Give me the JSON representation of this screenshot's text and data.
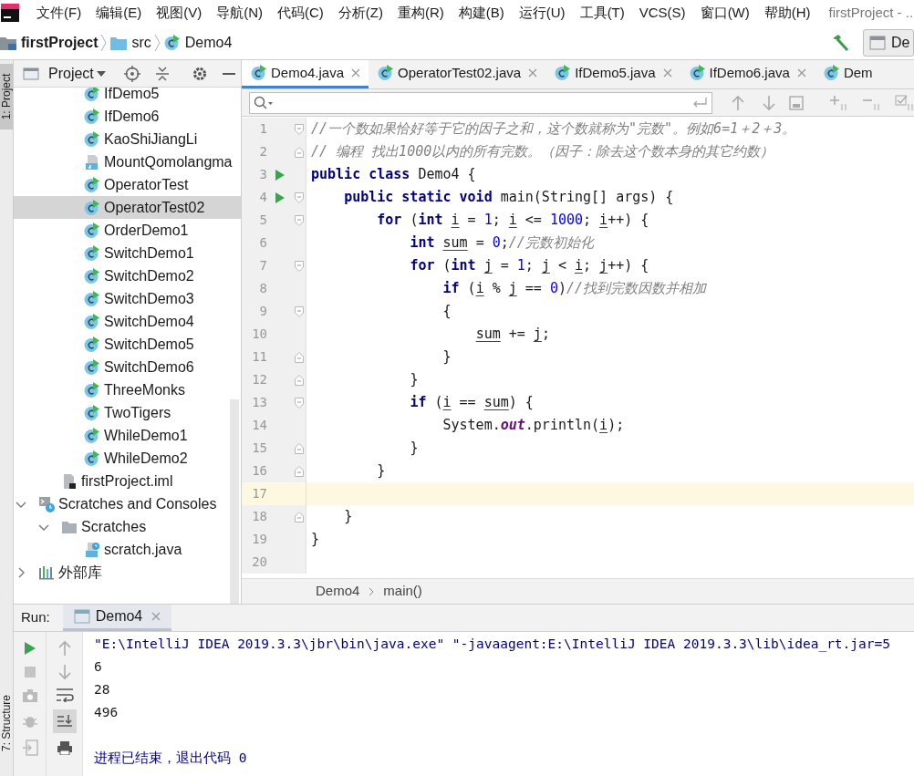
{
  "window": {
    "title": "firstProject - ..."
  },
  "menu": [
    "文件(F)",
    "编辑(E)",
    "视图(V)",
    "导航(N)",
    "代码(C)",
    "分析(Z)",
    "重构(R)",
    "构建(B)",
    "运行(U)",
    "工具(T)",
    "VCS(S)",
    "窗口(W)",
    "帮助(H)"
  ],
  "navigation_bar": {
    "path": [
      {
        "label": "firstProject",
        "kind": "project"
      },
      {
        "label": "src",
        "kind": "folder"
      },
      {
        "label": "Demo4",
        "kind": "class"
      }
    ],
    "run_configuration": "De"
  },
  "side_tabs": [
    {
      "label": "1: Project",
      "selected": true
    },
    {
      "label": "7: Structure",
      "selected": false
    }
  ],
  "project_panel": {
    "title": "Project",
    "tree": [
      {
        "children": [
          {
            "children": [
              {
                "label": "IfDemo5",
                "kind": "class",
                "selected": false
              },
              {
                "label": "IfDemo6",
                "kind": "class",
                "selected": false
              },
              {
                "label": "KaoShiJiangLi",
                "kind": "class",
                "selected": false
              },
              {
                "label": "MountQomolangma",
                "kind": "java_file",
                "selected": false
              },
              {
                "label": "OperatorTest",
                "kind": "class",
                "selected": false
              },
              {
                "label": "OperatorTest02",
                "kind": "class",
                "selected": true
              },
              {
                "label": "OrderDemo1",
                "kind": "class",
                "selected": false
              },
              {
                "label": "SwitchDemo1",
                "kind": "class",
                "selected": false
              },
              {
                "label": "SwitchDemo2",
                "kind": "class",
                "selected": false
              },
              {
                "label": "SwitchDemo3",
                "kind": "class",
                "selected": false
              },
              {
                "label": "SwitchDemo4",
                "kind": "class",
                "selected": false
              },
              {
                "label": "SwitchDemo5",
                "kind": "class",
                "selected": false
              },
              {
                "label": "SwitchDemo6",
                "kind": "class",
                "selected": false
              },
              {
                "label": "ThreeMonks",
                "kind": "class",
                "selected": false
              },
              {
                "label": "TwoTigers",
                "kind": "class",
                "selected": false
              },
              {
                "label": "WhileDemo1",
                "kind": "class",
                "selected": false
              },
              {
                "label": "WhileDemo2",
                "kind": "class",
                "selected": false
              }
            ]
          },
          {
            "label": "firstProject.iml",
            "kind": "module_file",
            "selected": false
          }
        ]
      },
      {
        "label": "Scratches and Consoles",
        "kind": "scratches",
        "selected": false,
        "expanded": true,
        "children": [
          {
            "label": "Scratches",
            "kind": "folder",
            "selected": false,
            "expanded": true,
            "children": [
              {
                "label": "scratch.java",
                "kind": "scratch_file",
                "selected": false
              }
            ]
          }
        ]
      },
      {
        "label": "外部库",
        "kind": "library",
        "selected": false,
        "expanded": false
      }
    ]
  },
  "editor": {
    "tabs": [
      {
        "label": "Demo4.java",
        "selected": true,
        "closable": true
      },
      {
        "label": "OperatorTest02.java",
        "selected": false,
        "closable": true
      },
      {
        "label": "IfDemo5.java",
        "selected": false,
        "closable": true
      },
      {
        "label": "IfDemo6.java",
        "selected": false,
        "closable": true
      },
      {
        "label": "Dem",
        "selected": false,
        "closable": false
      }
    ],
    "lines": [
      {
        "number": "1",
        "fold_start": true,
        "tokens": [
          {
            "kind": "comment",
            "text": "//一个数如果恰好等于它的因子之和，这个数就称为\"完数\"。例如6=1＋2＋3。"
          }
        ]
      },
      {
        "number": "2",
        "fold_end": true,
        "tokens": [
          {
            "kind": "comment",
            "text": "// 编程 找出1000以内的所有完数。（因子：除去这个数本身的其它约数）"
          }
        ]
      },
      {
        "number": "3",
        "run": true,
        "tokens": [
          {
            "kind": "keyword",
            "text": "public class"
          },
          {
            "kind": "plain",
            "text": " Demo4 {"
          }
        ]
      },
      {
        "number": "4",
        "run": true,
        "fold_start": true,
        "tokens": [
          {
            "kind": "keyword",
            "text": "    public static void"
          },
          {
            "kind": "plain",
            "text": " main(String[] args) {"
          }
        ]
      },
      {
        "number": "5",
        "fold_start": true,
        "tokens": [
          {
            "kind": "keyword",
            "text": "        for"
          },
          {
            "kind": "plain",
            "text": " ("
          },
          {
            "kind": "keyword",
            "text": "int "
          },
          {
            "kind": "variable",
            "text": "i"
          },
          {
            "kind": "plain",
            "text": " = "
          },
          {
            "kind": "number",
            "text": "1"
          },
          {
            "kind": "plain",
            "text": "; "
          },
          {
            "kind": "variable",
            "text": "i"
          },
          {
            "kind": "plain",
            "text": " <= "
          },
          {
            "kind": "number",
            "text": "1000"
          },
          {
            "kind": "plain",
            "text": "; "
          },
          {
            "kind": "variable",
            "text": "i"
          },
          {
            "kind": "plain",
            "text": "++) {"
          }
        ]
      },
      {
        "number": "6",
        "tokens": [
          {
            "kind": "keyword",
            "text": "            int "
          },
          {
            "kind": "variable",
            "text": "sum"
          },
          {
            "kind": "plain",
            "text": " = "
          },
          {
            "kind": "number",
            "text": "0"
          },
          {
            "kind": "plain",
            "text": ";"
          },
          {
            "kind": "comment",
            "text": "//完数初始化"
          }
        ]
      },
      {
        "number": "7",
        "fold_start": true,
        "tokens": [
          {
            "kind": "keyword",
            "text": "            for"
          },
          {
            "kind": "plain",
            "text": " ("
          },
          {
            "kind": "keyword",
            "text": "int "
          },
          {
            "kind": "variable",
            "text": "j"
          },
          {
            "kind": "plain",
            "text": " = "
          },
          {
            "kind": "number",
            "text": "1"
          },
          {
            "kind": "plain",
            "text": "; "
          },
          {
            "kind": "variable",
            "text": "j"
          },
          {
            "kind": "plain",
            "text": " < "
          },
          {
            "kind": "variable",
            "text": "i"
          },
          {
            "kind": "plain",
            "text": "; "
          },
          {
            "kind": "variable",
            "text": "j"
          },
          {
            "kind": "plain",
            "text": "++) {"
          }
        ]
      },
      {
        "number": "8",
        "tokens": [
          {
            "kind": "keyword",
            "text": "                if"
          },
          {
            "kind": "plain",
            "text": " ("
          },
          {
            "kind": "variable",
            "text": "i"
          },
          {
            "kind": "plain",
            "text": " % "
          },
          {
            "kind": "variable",
            "text": "j"
          },
          {
            "kind": "plain",
            "text": " == "
          },
          {
            "kind": "number",
            "text": "0"
          },
          {
            "kind": "plain",
            "text": ")"
          },
          {
            "kind": "comment",
            "text": "//找到完数因数并相加"
          }
        ]
      },
      {
        "number": "9",
        "fold_start": true,
        "tokens": [
          {
            "kind": "plain",
            "text": "                {"
          }
        ]
      },
      {
        "number": "10",
        "tokens": [
          {
            "kind": "variable",
            "text": "                    sum"
          },
          {
            "kind": "plain",
            "text": " += "
          },
          {
            "kind": "variable",
            "text": "j"
          },
          {
            "kind": "plain",
            "text": ";"
          }
        ]
      },
      {
        "number": "11",
        "fold_end": true,
        "tokens": [
          {
            "kind": "plain",
            "text": "                }"
          }
        ]
      },
      {
        "number": "12",
        "fold_end": true,
        "tokens": [
          {
            "kind": "plain",
            "text": "            }"
          }
        ]
      },
      {
        "number": "13",
        "fold_start": true,
        "tokens": [
          {
            "kind": "keyword",
            "text": "            if"
          },
          {
            "kind": "plain",
            "text": " ("
          },
          {
            "kind": "variable",
            "text": "i"
          },
          {
            "kind": "plain",
            "text": " == "
          },
          {
            "kind": "variable",
            "text": "sum"
          },
          {
            "kind": "plain",
            "text": ") {"
          }
        ]
      },
      {
        "number": "14",
        "tokens": [
          {
            "kind": "plain",
            "text": "                System."
          },
          {
            "kind": "static_field",
            "text": "out"
          },
          {
            "kind": "plain",
            "text": ".println("
          },
          {
            "kind": "variable",
            "text": "i"
          },
          {
            "kind": "plain",
            "text": ");"
          }
        ]
      },
      {
        "number": "15",
        "fold_end": true,
        "tokens": [
          {
            "kind": "plain",
            "text": "            }"
          }
        ]
      },
      {
        "number": "16",
        "fold_end": true,
        "tokens": [
          {
            "kind": "plain",
            "text": "        }"
          }
        ]
      },
      {
        "number": "17",
        "current": true
      },
      {
        "number": "18",
        "fold_end": true,
        "tokens": [
          {
            "kind": "plain",
            "text": "    }"
          }
        ]
      },
      {
        "number": "19",
        "tokens": [
          {
            "kind": "plain",
            "text": "}"
          }
        ]
      },
      {
        "number": "20"
      }
    ],
    "breadcrumbs": [
      "Demo4",
      "main()"
    ]
  },
  "run_panel": {
    "label": "Run:",
    "tabs": [
      {
        "label": "Demo4",
        "selected": true
      }
    ],
    "console": [
      {
        "kind": "command",
        "text": "\"E:\\IntelliJ IDEA 2019.3.3\\jbr\\bin\\java.exe\" \"-javaagent:E:\\IntelliJ IDEA 2019.3.3\\lib\\idea_rt.jar=5"
      },
      {
        "kind": "output",
        "text": "6"
      },
      {
        "kind": "output",
        "text": "28"
      },
      {
        "kind": "output",
        "text": "496"
      },
      {
        "kind": "status",
        "text": "进程已结束，退出代码 0"
      }
    ]
  }
}
